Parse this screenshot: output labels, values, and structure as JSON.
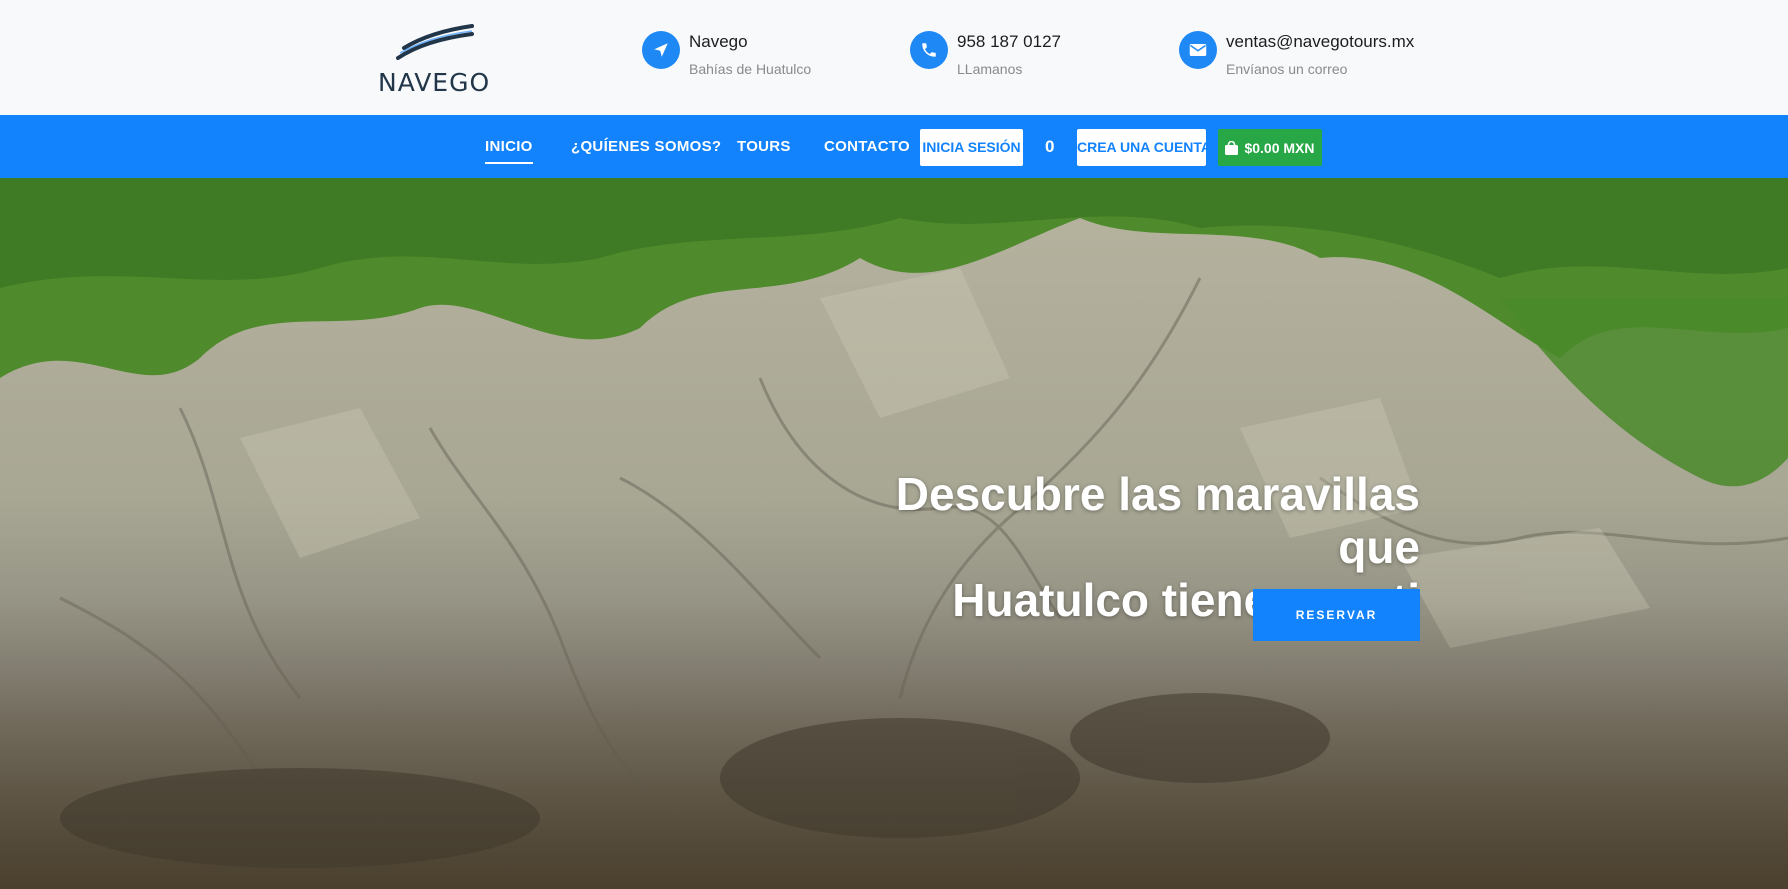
{
  "brand": {
    "name": "NAVEGO"
  },
  "contacts": [
    {
      "icon": "navigation-arrow-icon",
      "title": "Navego",
      "subtitle": "Bahías de Huatulco"
    },
    {
      "icon": "phone-icon",
      "title": "958 187 0127",
      "subtitle": "LLamanos"
    },
    {
      "icon": "envelope-icon",
      "title": "ventas@navegotours.mx",
      "subtitle": "Envíanos un correo"
    }
  ],
  "nav": {
    "links": [
      {
        "label": "INICIO",
        "active": true
      },
      {
        "label": "¿QUÍENES SOMOS?"
      },
      {
        "label": "TOURS"
      },
      {
        "label": "CONTACTO"
      }
    ],
    "login_label": "INICIA SESIÓN",
    "cart_count": "0",
    "register_label": "CREA UNA CUENTA",
    "cart_total": "$0.00 MXN"
  },
  "hero": {
    "title_line1": "Descubre las maravillas que",
    "title_line2": "Huatulco tiene para ti",
    "cta_label": "RESERVAR"
  },
  "colors": {
    "primary": "#1283fc",
    "cart_green": "#27a745",
    "header_bg": "#f8f9fb"
  }
}
